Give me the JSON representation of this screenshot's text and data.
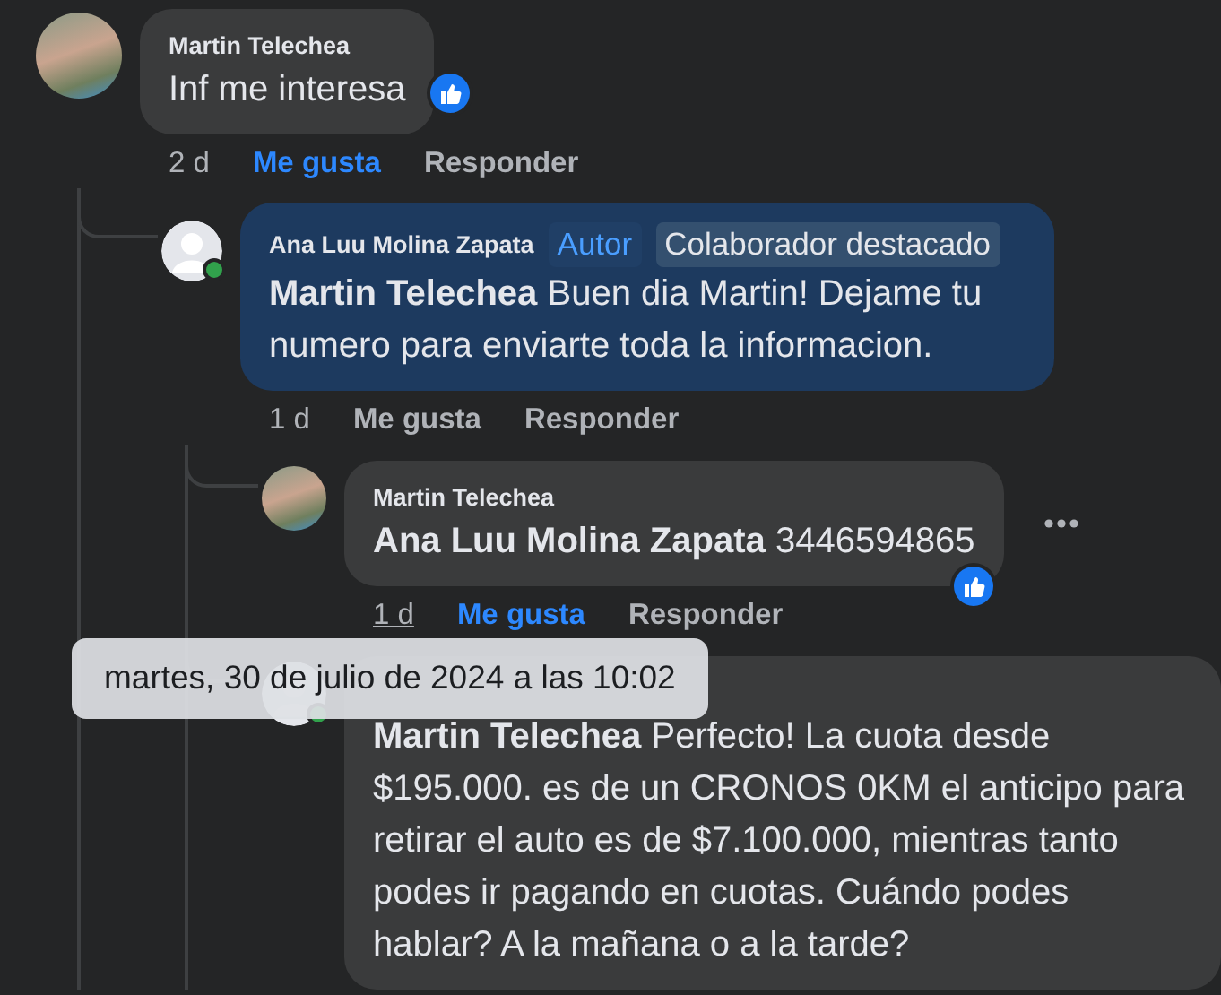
{
  "comments": [
    {
      "author": "Martin Telechea",
      "avatar_photo": true,
      "online": false,
      "highlighted": false,
      "text": "Inf me interesa",
      "like_reaction": true,
      "time": "2 d",
      "time_underlined": false,
      "like_label": "Me gusta",
      "liked": true,
      "reply_label": "Responder",
      "more_menu": false,
      "children": [
        {
          "author": "Ana Luu Molina Zapata",
          "avatar_photo": false,
          "online": true,
          "highlighted": true,
          "badges": [
            {
              "label": "Autor",
              "kind": "author"
            },
            {
              "label": "Colaborador destacado",
              "kind": "plain"
            }
          ],
          "mention": "Martin Telechea",
          "text": "Buen dia Martin! Dejame tu numero para enviarte toda la informacion.",
          "like_reaction": false,
          "time": "1 d",
          "time_underlined": false,
          "like_label": "Me gusta",
          "liked": false,
          "reply_label": "Responder",
          "more_menu": false,
          "children": [
            {
              "author": "Martin Telechea",
              "avatar_photo": true,
              "online": false,
              "highlighted": false,
              "mention": "Ana Luu Molina Zapata",
              "text": "3446594865",
              "like_reaction": true,
              "time": "1 d",
              "time_underlined": true,
              "like_label": "Me gusta",
              "liked": true,
              "reply_label": "Responder",
              "more_menu": true
            },
            {
              "avatar_photo": false,
              "online": true,
              "highlighted": false,
              "mention": "Martin Telechea",
              "text": "Perfecto! La cuota desde $195.000. es de un CRONOS 0KM el anticipo para retirar el auto es de $7.100.000, mientras tanto podes ir pagando en cuotas. Cuándo podes hablar? A la mañana o a la tarde?",
              "like_reaction": false,
              "more_menu": false
            }
          ]
        }
      ]
    }
  ],
  "tooltip": {
    "text": "martes, 30 de julio de 2024 a las 10:02"
  }
}
